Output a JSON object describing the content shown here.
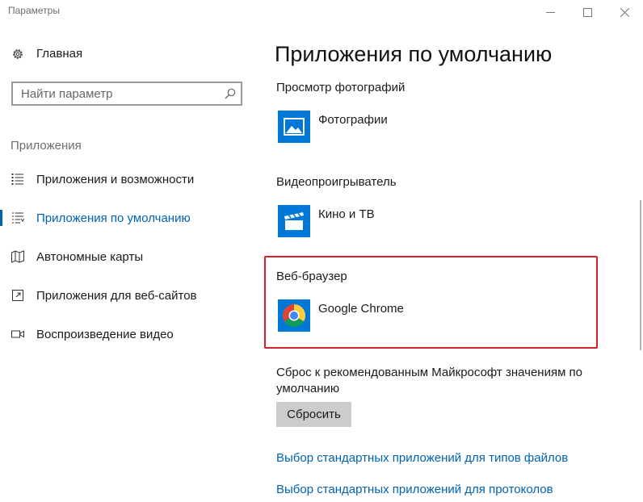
{
  "window": {
    "title": "Параметры",
    "controls": {
      "minimize_icon": "minimize-icon",
      "maximize_icon": "maximize-icon",
      "close_icon": "close-icon"
    }
  },
  "sidebar": {
    "home_label": "Главная",
    "home_icon": "gear-icon",
    "search_placeholder": "Найти параметр",
    "search_icon": "search-icon",
    "section_label": "Приложения",
    "items": [
      {
        "label": "Приложения и возможности",
        "icon": "apps-list-icon",
        "active": false
      },
      {
        "label": "Приложения по умолчанию",
        "icon": "default-apps-icon",
        "active": true
      },
      {
        "label": "Автономные карты",
        "icon": "map-icon",
        "active": false
      },
      {
        "label": "Приложения для веб-сайтов",
        "icon": "open-in-window-icon",
        "active": false
      },
      {
        "label": "Воспроизведение видео",
        "icon": "video-icon",
        "active": false
      }
    ]
  },
  "main": {
    "title": "Приложения по умолчанию",
    "photo_viewer": {
      "heading": "Просмотр фотографий",
      "app_name": "Фотографии",
      "icon": "photos-app-icon"
    },
    "video_player": {
      "heading": "Видеопроигрыватель",
      "app_name": "Кино и ТВ",
      "icon": "movies-tv-app-icon"
    },
    "web_browser": {
      "heading": "Веб-браузер",
      "app_name": "Google Chrome",
      "icon": "chrome-app-icon"
    },
    "reset": {
      "text": "Сброс к рекомендованным Майкрософт значениям по умолчанию",
      "button_label": "Сбросить"
    },
    "links": [
      "Выбор стандартных приложений для типов файлов",
      "Выбор стандартных приложений для протоколов"
    ]
  },
  "colors": {
    "accent": "#0063b1",
    "tile_blue": "#0078d7",
    "highlight_red": "#d3222a",
    "button_gray": "#cccccc"
  }
}
